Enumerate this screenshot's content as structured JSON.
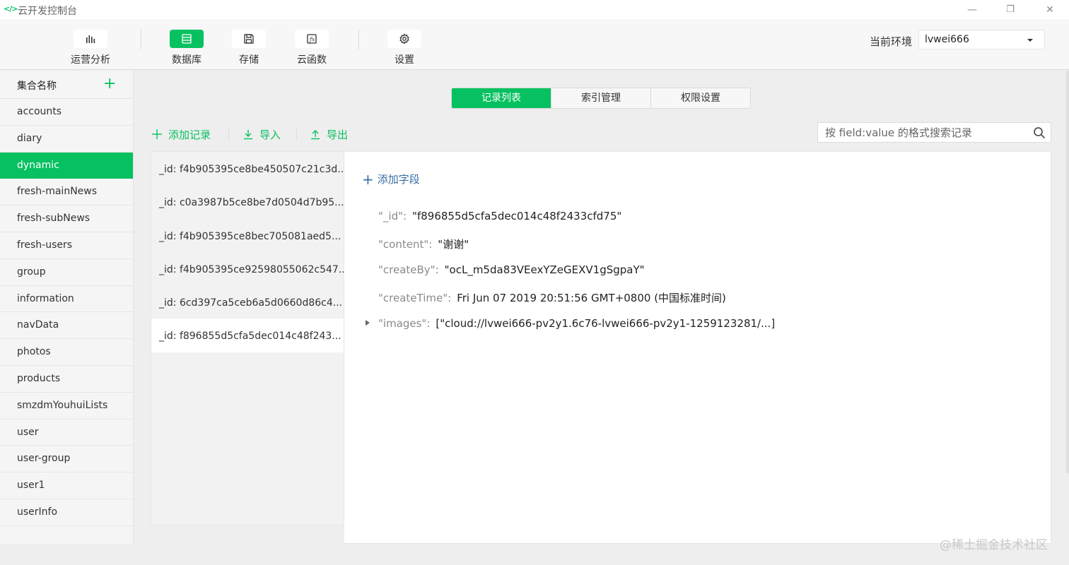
{
  "window": {
    "logo": "</>",
    "title": "云开发控制台",
    "minimize": "—",
    "restore": "❐",
    "close": "✕"
  },
  "toolbar": {
    "items": [
      {
        "label": "运营分析",
        "icon": "bar-chart-icon"
      },
      {
        "label": "数据库",
        "icon": "database-icon",
        "active": true
      },
      {
        "label": "存储",
        "icon": "save-icon"
      },
      {
        "label": "云函数",
        "icon": "function-icon"
      },
      {
        "label": "设置",
        "icon": "gear-icon"
      }
    ],
    "env_label": "当前环境",
    "env_value": "lvwei666"
  },
  "sidebar": {
    "header": "集合名称",
    "add_symbol": "+",
    "items": [
      {
        "label": "accounts"
      },
      {
        "label": "diary"
      },
      {
        "label": "dynamic",
        "active": true
      },
      {
        "label": "fresh-mainNews"
      },
      {
        "label": "fresh-subNews"
      },
      {
        "label": "fresh-users"
      },
      {
        "label": "group"
      },
      {
        "label": "information"
      },
      {
        "label": "navData"
      },
      {
        "label": "photos"
      },
      {
        "label": "products"
      },
      {
        "label": "smzdmYouhuiLists"
      },
      {
        "label": "user"
      },
      {
        "label": "user-group"
      },
      {
        "label": "user1"
      },
      {
        "label": "userInfo"
      }
    ]
  },
  "tabs": [
    {
      "label": "记录列表",
      "active": true
    },
    {
      "label": "索引管理"
    },
    {
      "label": "权限设置"
    }
  ],
  "actions": {
    "add_record": "添加记录",
    "import": "导入",
    "export": "导出"
  },
  "search": {
    "placeholder": "按 field:value 的格式搜索记录"
  },
  "records": [
    {
      "label": "_id: f4b905395ce8be450507c21c3d..."
    },
    {
      "label": "_id: c0a3987b5ce8be7d0504d7b95..."
    },
    {
      "label": "_id: f4b905395ce8bec705081aed5..."
    },
    {
      "label": "_id: f4b905395ce92598055062c547..."
    },
    {
      "label": "_id: 6cd397ca5ceb6a5d0660d86c4..."
    },
    {
      "label": "_id: f896855d5cfa5dec014c48f243...",
      "active": true
    }
  ],
  "detail": {
    "add_field": "添加字段",
    "add_symbol": "+",
    "fields": [
      {
        "key": "\"_id\":",
        "value": "\"f896855d5cfa5dec014c48f2433cfd75\""
      },
      {
        "key": "\"content\":",
        "value": "\"谢谢\""
      },
      {
        "key": "\"createBy\":",
        "value": "\"ocL_m5da83VEexYZeGEXV1gSgpaY\""
      },
      {
        "key": "\"createTime\":",
        "value": "Fri Jun 07 2019 20:51:56 GMT+0800 (中国标准时间)"
      },
      {
        "key": "\"images\":",
        "value": "[\"cloud://lvwei666-pv2y1.6c76-lvwei666-pv2y1-1259123281/...]"
      }
    ]
  },
  "watermark": "@稀土掘金技术社区",
  "colors": {
    "accent": "#07c160",
    "link": "#3a6ea5"
  }
}
